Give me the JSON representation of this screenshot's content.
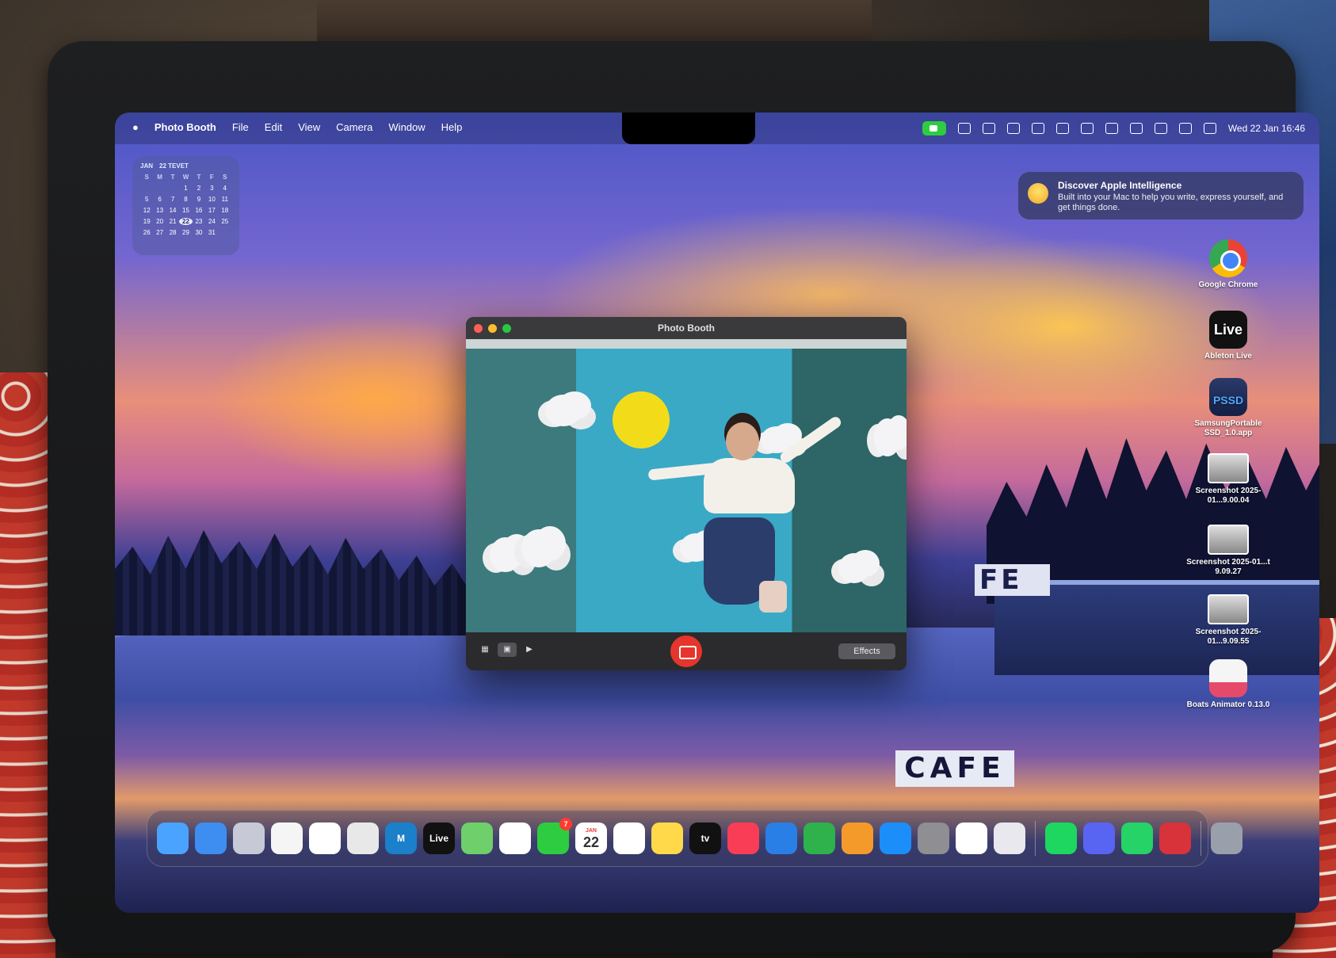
{
  "menubar": {
    "apple": "",
    "app_name": "Photo Booth",
    "menus": [
      "File",
      "Edit",
      "View",
      "Camera",
      "Window",
      "Help"
    ],
    "datetime": "Wed 22 Jan  16:46"
  },
  "calendar": {
    "month": "JAN",
    "hebrew": "22 TEVET",
    "weekdays": [
      "S",
      "M",
      "T",
      "W",
      "T",
      "F",
      "S"
    ],
    "days": [
      "",
      "",
      "",
      "1",
      "2",
      "3",
      "4",
      "5",
      "6",
      "7",
      "8",
      "9",
      "10",
      "11",
      "12",
      "13",
      "14",
      "15",
      "16",
      "17",
      "18",
      "19",
      "20",
      "21",
      "22",
      "23",
      "24",
      "25",
      "26",
      "27",
      "28",
      "29",
      "30",
      "31",
      ""
    ],
    "today": "22"
  },
  "notification": {
    "title": "Discover Apple Intelligence",
    "body": "Built into your Mac to help you write, express yourself, and get things done."
  },
  "desktop_icons": [
    {
      "label": "Google Chrome",
      "icon": "chrome-icon"
    },
    {
      "label": "Ableton Live",
      "icon": "ableton-live-icon",
      "glyph": "Live"
    },
    {
      "label": "SamsungPortable SSD_1.0.app",
      "icon": "samsung-ssd-icon",
      "glyph": "PSSD"
    },
    {
      "label": "Screenshot 2025-01...9.00.04",
      "icon": "screenshot-icon"
    },
    {
      "label": "Screenshot 2025-01...t 9.09.27",
      "icon": "screenshot-icon"
    },
    {
      "label": "Screenshot 2025-01...9.09.55",
      "icon": "screenshot-icon"
    },
    {
      "label": "Boats Animator 0.13.0",
      "icon": "boats-animator-icon"
    }
  ],
  "photo_booth": {
    "title": "Photo Booth",
    "view_modes": [
      "grid-view",
      "single-photo-view",
      "video-view"
    ],
    "active_view": "single-photo-view",
    "effects_label": "Effects"
  },
  "background": {
    "cafe_sign": "FE",
    "cafe_reflection": "CAFE"
  },
  "dock": {
    "items": [
      {
        "name": "finder",
        "color": "#4aa3ff"
      },
      {
        "name": "mail",
        "color": "#3d8ef0"
      },
      {
        "name": "launchpad",
        "color": "#c7c9d6"
      },
      {
        "name": "freeform",
        "color": "#f5f5f5"
      },
      {
        "name": "chrome",
        "color": "#ffffff"
      },
      {
        "name": "zbrush",
        "color": "#e8e8e8"
      },
      {
        "name": "maya",
        "color": "#1b7fc9",
        "glyph": "M"
      },
      {
        "name": "ableton-live",
        "color": "#111111",
        "glyph": "Live"
      },
      {
        "name": "maps",
        "color": "#6fcf6a"
      },
      {
        "name": "photos",
        "color": "#ffffff"
      },
      {
        "name": "facetime",
        "color": "#2ecc40",
        "badge": "7"
      },
      {
        "name": "calendar",
        "color": "#ffffff",
        "month": "JAN",
        "day": "22"
      },
      {
        "name": "reminders",
        "color": "#ffffff"
      },
      {
        "name": "notes",
        "color": "#ffd94a"
      },
      {
        "name": "apple-tv",
        "color": "#111111",
        "glyph": "tv"
      },
      {
        "name": "music",
        "color": "#fa3d57"
      },
      {
        "name": "keynote",
        "color": "#2a7fe6"
      },
      {
        "name": "numbers",
        "color": "#2fb24c"
      },
      {
        "name": "pages",
        "color": "#f39a2b"
      },
      {
        "name": "app-store",
        "color": "#1c8ef9"
      },
      {
        "name": "system-settings",
        "color": "#8e8e93"
      },
      {
        "name": "shortcuts",
        "color": "#ffffff"
      },
      {
        "name": "iphone-mirroring",
        "color": "#e8e8ee"
      },
      {
        "name": "spotify",
        "color": "#1ed760"
      },
      {
        "name": "discord",
        "color": "#5865f2"
      },
      {
        "name": "whatsapp",
        "color": "#25d366"
      },
      {
        "name": "photo-booth",
        "color": "#d8323a"
      },
      {
        "name": "trash",
        "color": "#9aa0ab"
      }
    ]
  }
}
